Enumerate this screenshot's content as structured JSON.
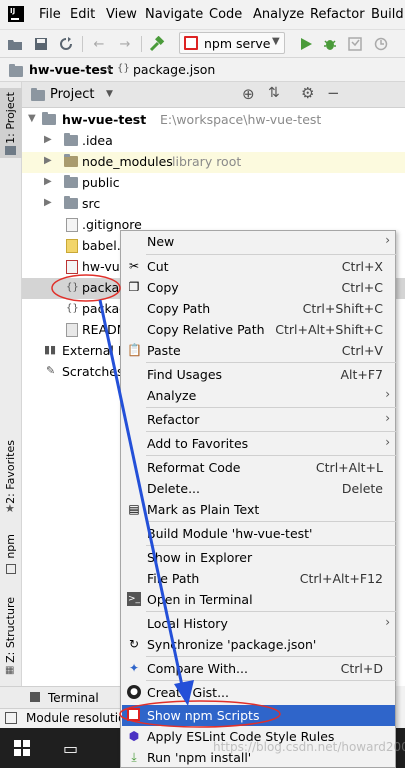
{
  "menubar": {
    "items": [
      "File",
      "Edit",
      "View",
      "Navigate",
      "Code",
      "Analyze",
      "Refactor",
      "Build"
    ]
  },
  "toolbar": {
    "run_config": "npm serve"
  },
  "breadcrumb": {
    "project": "hw-vue-test",
    "file": "package.json"
  },
  "stripe": {
    "project": "1: Project",
    "favorites": "2: Favorites",
    "npm": "npm",
    "structure": "Z: Structure"
  },
  "panel": {
    "title": "Project"
  },
  "tree": {
    "root_name": "hw-vue-test",
    "root_path": "E:\\workspace\\hw-vue-test",
    "items": [
      {
        "label": ".idea"
      },
      {
        "label": "node_modules",
        "note": "library root"
      },
      {
        "label": "public"
      },
      {
        "label": "src"
      },
      {
        "label": ".gitignore"
      },
      {
        "label": "babel.c"
      },
      {
        "label": "hw-vue"
      },
      {
        "label": "packag"
      },
      {
        "label": "packag"
      },
      {
        "label": "READM"
      },
      {
        "label": "External Li"
      },
      {
        "label": "Scratches"
      }
    ]
  },
  "context_menu": {
    "items": [
      {
        "label": "New",
        "shortcut": ""
      },
      {
        "label": "Cut",
        "shortcut": "Ctrl+X"
      },
      {
        "label": "Copy",
        "shortcut": "Ctrl+C"
      },
      {
        "label": "Copy Path",
        "shortcut": "Ctrl+Shift+C"
      },
      {
        "label": "Copy Relative Path",
        "shortcut": "Ctrl+Alt+Shift+C"
      },
      {
        "label": "Paste",
        "shortcut": "Ctrl+V"
      },
      {
        "label": "Find Usages",
        "shortcut": "Alt+F7"
      },
      {
        "label": "Analyze",
        "shortcut": ""
      },
      {
        "label": "Refactor",
        "shortcut": ""
      },
      {
        "label": "Add to Favorites",
        "shortcut": ""
      },
      {
        "label": "Reformat Code",
        "shortcut": "Ctrl+Alt+L"
      },
      {
        "label": "Delete...",
        "shortcut": "Delete"
      },
      {
        "label": "Mark as Plain Text",
        "shortcut": ""
      },
      {
        "label": "Build Module 'hw-vue-test'",
        "shortcut": ""
      },
      {
        "label": "Show in Explorer",
        "shortcut": ""
      },
      {
        "label": "File Path",
        "shortcut": "Ctrl+Alt+F12"
      },
      {
        "label": "Open in Terminal",
        "shortcut": ""
      },
      {
        "label": "Local History",
        "shortcut": ""
      },
      {
        "label": "Synchronize 'package.json'",
        "shortcut": ""
      },
      {
        "label": "Compare With...",
        "shortcut": "Ctrl+D"
      },
      {
        "label": "Create Gist...",
        "shortcut": ""
      },
      {
        "label": "Show npm Scripts",
        "shortcut": ""
      },
      {
        "label": "Apply ESLint Code Style Rules",
        "shortcut": ""
      },
      {
        "label": "Run 'npm install'",
        "shortcut": ""
      }
    ]
  },
  "bottom": {
    "terminal_tab": "Terminal",
    "status_text": "Module resolutio"
  },
  "watermark": "https://blog.csdn.net/howard2005",
  "colors": {
    "selection": "#2f65ca",
    "annotation": "#e0302a",
    "arrow": "#2450d8"
  }
}
